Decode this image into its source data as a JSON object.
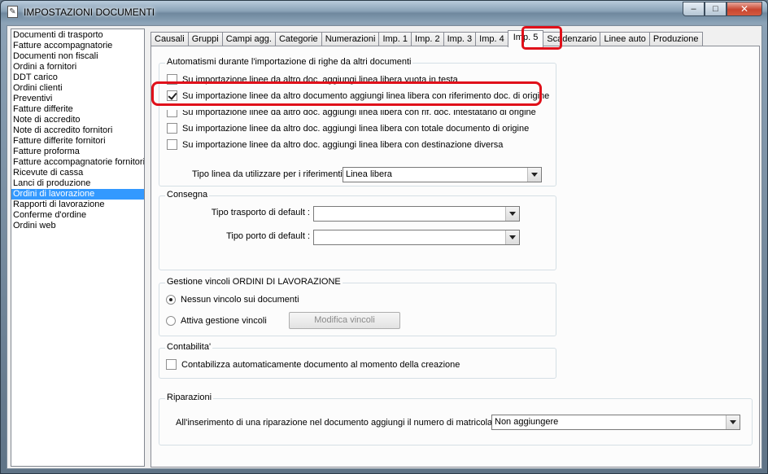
{
  "window": {
    "title": "IMPOSTAZIONI DOCUMENTI",
    "minimize_glyph": "–",
    "maximize_glyph": "□",
    "close_glyph": "✕"
  },
  "doc_list": {
    "items": [
      "Documenti di trasporto",
      "Fatture accompagnatorie",
      "Documenti non fiscali",
      "Ordini a fornitori",
      "DDT carico",
      "Ordini clienti",
      "Preventivi",
      "Fatture differite",
      "Note di accredito",
      "Note di accredito fornitori",
      "Fatture differite fornitori",
      "Fatture proforma",
      "Fatture accompagnatorie fornitori",
      "Ricevute di cassa",
      "Lanci di produzione",
      "Ordini di lavorazione",
      "Rapporti di lavorazione",
      "Conferme d'ordine",
      "Ordini web"
    ],
    "selected": "Ordini di lavorazione"
  },
  "tabs": [
    "Causali",
    "Gruppi",
    "Campi agg.",
    "Categorie",
    "Numerazioni",
    "Imp. 1",
    "Imp. 2",
    "Imp. 3",
    "Imp. 4",
    "Imp. 5",
    "Scadenzario",
    "Linee auto",
    "Produzione"
  ],
  "active_tab": "Imp. 5",
  "automatismi": {
    "title": "Automatismi durante l'importazione di righe da altri documenti",
    "options": [
      {
        "label": "Su importazione linee da altro doc. aggiungi linea libera vuota in testa",
        "checked": false
      },
      {
        "label": "Su importazione linee da altro documento aggiungi linea libera con riferimento doc. di origine",
        "checked": true
      },
      {
        "label": "Su importazione linee da altro doc. aggiungi linea libera con rif. doc. intestatario di origine",
        "checked": false
      },
      {
        "label": "Su importazione linee da altro doc. aggiungi linea libera con totale documento di origine",
        "checked": false
      },
      {
        "label": "Su importazione linee da altro doc. aggiungi linea libera con destinazione diversa",
        "checked": false
      }
    ],
    "tipo_linea_label": "Tipo linea da utilizzare per i riferimenti :",
    "tipo_linea_value": "Linea libera"
  },
  "consegna": {
    "title": "Consegna",
    "trasporto_label": "Tipo trasporto di default :",
    "trasporto_value": "",
    "porto_label": "Tipo porto di default :",
    "porto_value": ""
  },
  "vincoli": {
    "title": "Gestione vincoli ORDINI DI LAVORAZIONE",
    "nessuno_label": "Nessun vincolo sui documenti",
    "attiva_label": "Attiva gestione vincoli",
    "selected": "nessuno",
    "modifica_button": "Modifica vincoli"
  },
  "contabilita": {
    "title": "Contabilita'",
    "option_label": "Contabilizza automaticamente documento al momento della creazione",
    "checked": false
  },
  "riparazioni": {
    "title": "Riparazioni",
    "matricola_label": "All'inserimento di una riparazione nel documento aggiungi il numero di matricola :",
    "matricola_value": "Non aggiungere"
  }
}
